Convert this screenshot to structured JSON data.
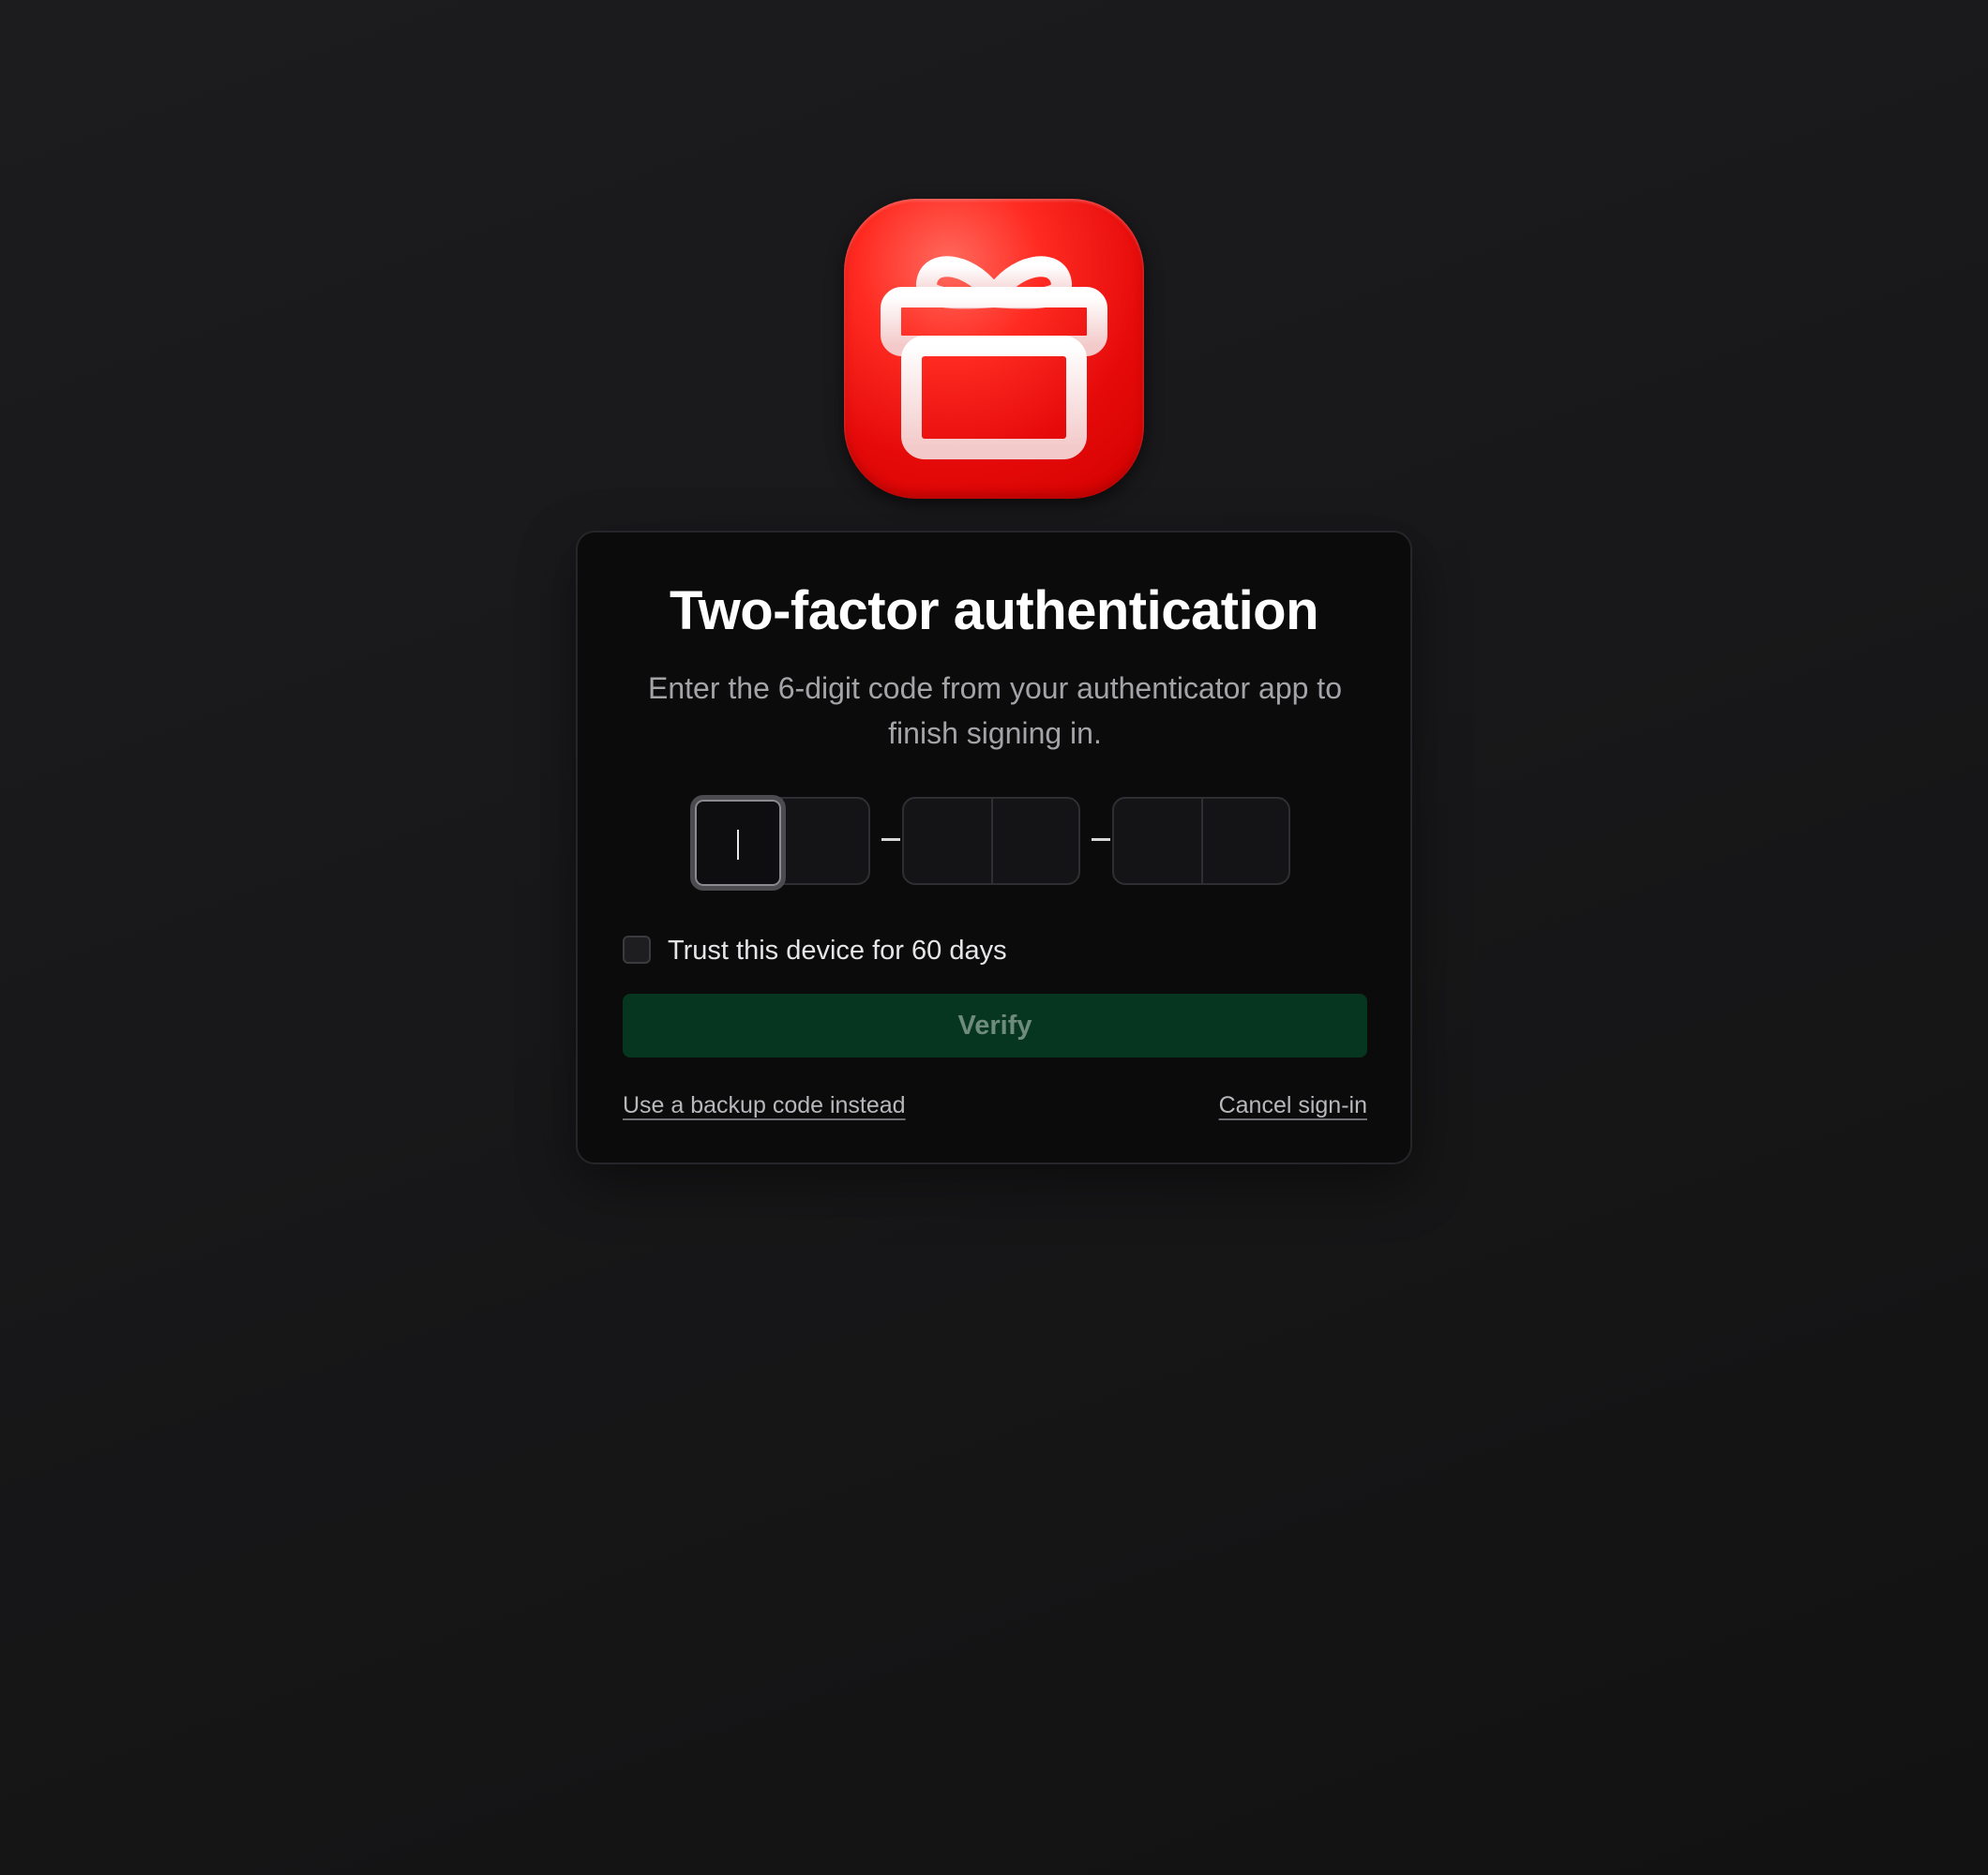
{
  "app": {
    "icon": "gift-icon",
    "accent_color": "#e50a0a"
  },
  "dialog": {
    "title": "Two-factor authentication",
    "subtitle": "Enter the 6-digit code from your authenticator app to finish signing in."
  },
  "otp": {
    "digits": [
      "",
      "",
      "",
      "",
      "",
      ""
    ],
    "separator": "–",
    "active_index": 0
  },
  "trust": {
    "label": "Trust this device for 60 days",
    "checked": false
  },
  "actions": {
    "verify_label": "Verify",
    "verify_color": "#063620",
    "backup_label": "Use a backup code instead",
    "cancel_label": "Cancel sign-in"
  }
}
